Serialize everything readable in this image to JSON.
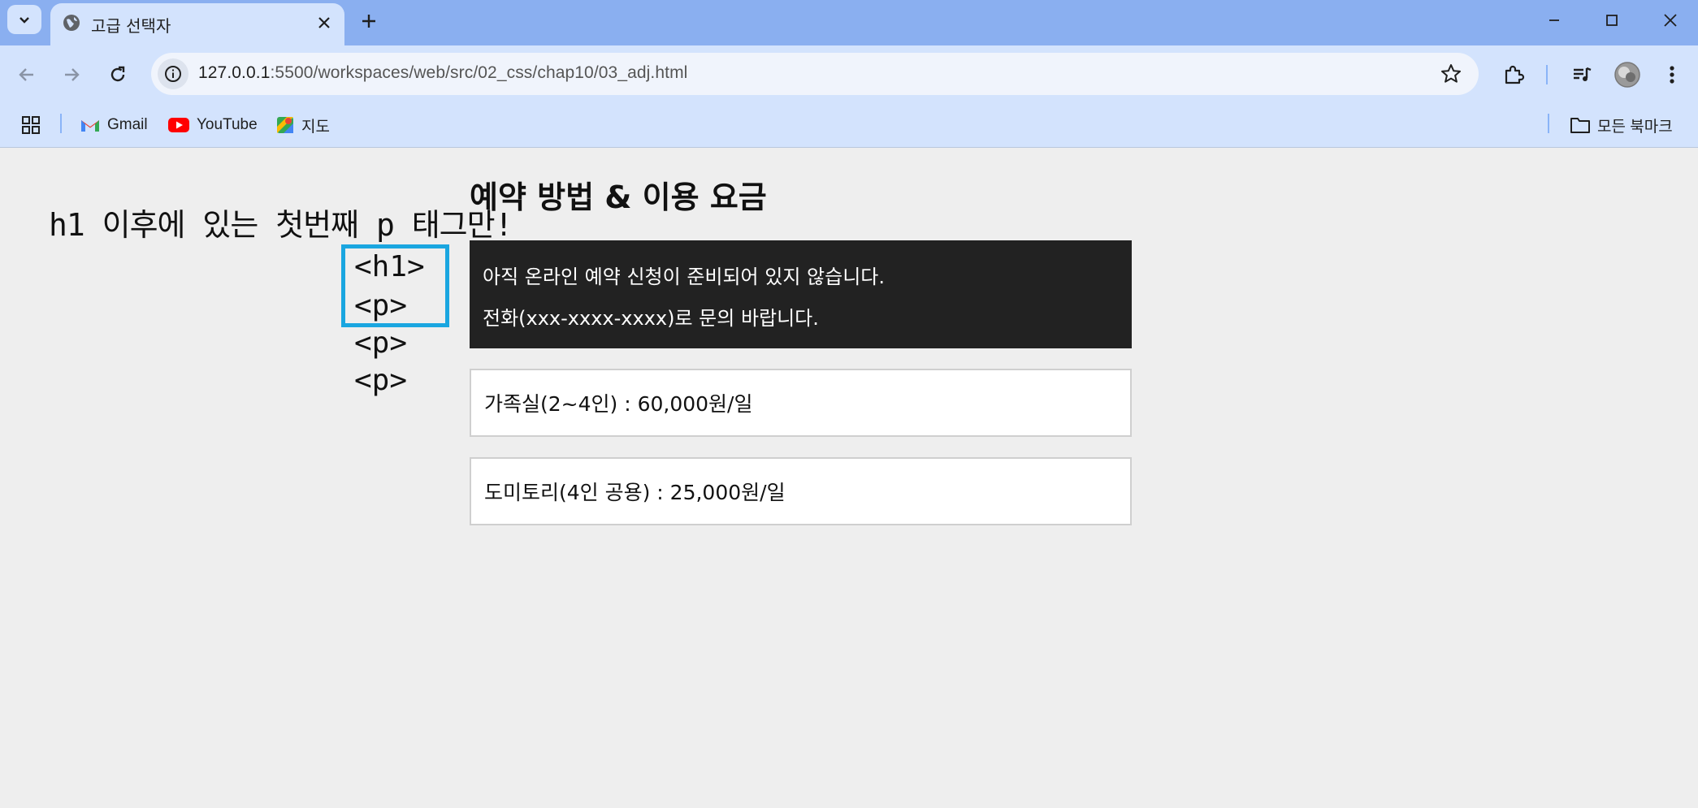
{
  "browser": {
    "tab_title": "고급 선택자",
    "url_host": "127.0.0.1",
    "url_rest": ":5500/workspaces/web/src/02_css/chap10/03_adj.html",
    "bookmarks": [
      {
        "label": "Gmail"
      },
      {
        "label": "YouTube"
      },
      {
        "label": "지도"
      }
    ],
    "all_bookmarks_label": "모든 북마크"
  },
  "annotation": {
    "title": "h1 이후에 있는 첫번째 p 태그만!",
    "tags": [
      "<h1>",
      "<p>",
      "<p>",
      "<p>"
    ],
    "highlight_color": "#1aa6e0"
  },
  "page": {
    "heading": "예약 방법 & 이용 요금",
    "notice_lines": [
      "아직 온라인 예약 신청이 준비되어 있지 않습니다.",
      "전화(xxx-xxxx-xxxx)로 문의 바랍니다."
    ],
    "prices": [
      "가족실(2~4인) : 60,000원/일",
      "도미토리(4인 공용) : 25,000원/일"
    ]
  },
  "colors": {
    "tabbar": "#8aaff0",
    "toolbar": "#d3e3fd",
    "page_bg": "#eeeeee",
    "notice_bg": "#222222"
  }
}
